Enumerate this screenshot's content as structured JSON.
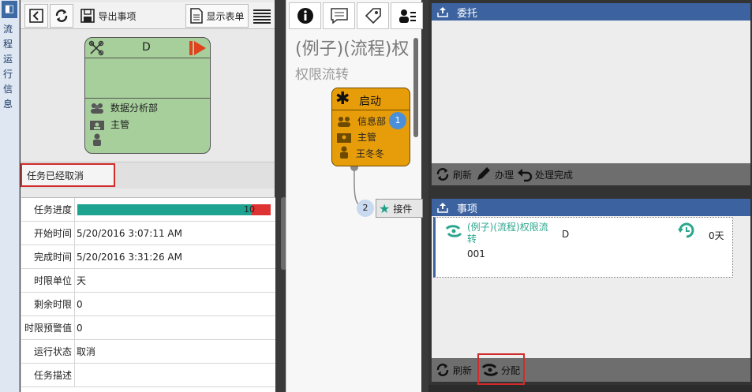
{
  "side_strip": {
    "text": "流程运行信息"
  },
  "toolbar": {
    "export_label": "导出事项",
    "show_form_label": "显示表单"
  },
  "node": {
    "letter": "D",
    "dept": "数据分析部",
    "role": "主管"
  },
  "status_text": "任务已经取消",
  "details": {
    "progress_label": "任务进度",
    "progress_value": "10",
    "progress_fraction": 0.9,
    "rows": [
      {
        "label": "开始时间",
        "value": "5/20/2016 3:07:11 AM"
      },
      {
        "label": "完成时间",
        "value": "5/20/2016 3:31:26 AM"
      },
      {
        "label": "时限单位",
        "value": "天"
      },
      {
        "label": "剩余时限",
        "value": "0"
      },
      {
        "label": "时限预警值",
        "value": "0"
      },
      {
        "label": "运行状态",
        "value": "取消"
      },
      {
        "label": "任务描述",
        "value": ""
      }
    ]
  },
  "flow": {
    "title": "(例子)(流程)权",
    "subtitle": "权限流转",
    "start_label": "启动",
    "start_dept": "信息部",
    "start_badge": "1",
    "start_role": "主管",
    "start_person": "王冬冬",
    "next_badge": "2",
    "next_label": "接件"
  },
  "delegate_panel": {
    "title": "委托",
    "buttons": {
      "refresh": "刷新",
      "handle": "办理",
      "complete": "处理完成"
    }
  },
  "items_panel": {
    "title": "事项",
    "item": {
      "name": "(例子)(流程)权限流转",
      "code": "001",
      "node": "D",
      "days": "0天"
    },
    "buttons": {
      "refresh": "刷新",
      "assign": "分配"
    }
  },
  "colors": {
    "accent": "#3c63a0",
    "node_green": "#a6cf9b",
    "start_orange": "#e79d09",
    "teal": "#2aa68e",
    "highlight_red": "#d12b2b"
  }
}
